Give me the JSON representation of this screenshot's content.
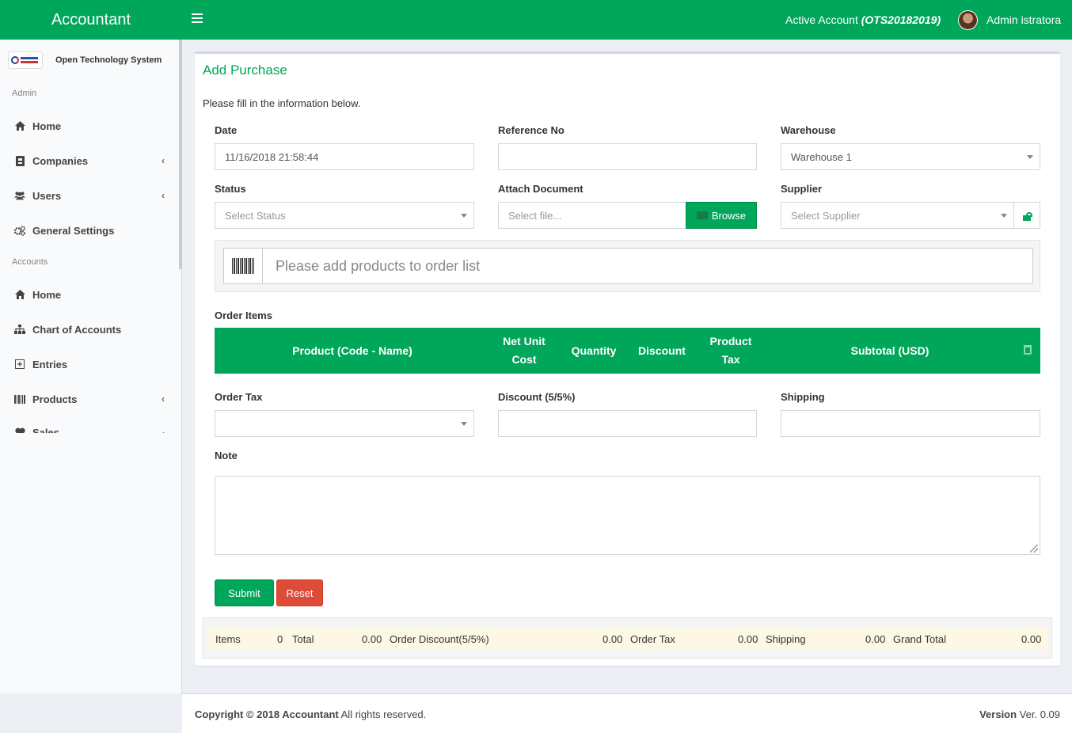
{
  "header": {
    "brand": "Accountant",
    "active_account_label": "Active Account",
    "active_account_code": "(OTS20182019)",
    "user_name": "Admin istratora"
  },
  "sidebar": {
    "org_name": "Open Technology System",
    "sections": [
      {
        "title": "Admin"
      },
      {
        "title": "Accounts"
      }
    ],
    "items": [
      {
        "label": "Home",
        "icon": "home-icon"
      },
      {
        "label": "Companies",
        "icon": "building-icon"
      },
      {
        "label": "Users",
        "icon": "users-icon"
      },
      {
        "label": "General Settings",
        "icon": "cogs-icon"
      },
      {
        "label": "Home",
        "icon": "home-icon"
      },
      {
        "label": "Chart of Accounts",
        "icon": "sitemap-icon"
      },
      {
        "label": "Entries",
        "icon": "plus-square-icon"
      },
      {
        "label": "Products",
        "icon": "barcode-icon"
      },
      {
        "label": "Sales",
        "icon": "heart-icon"
      }
    ]
  },
  "form": {
    "title": "Add Purchase",
    "intro": "Please fill in the information below.",
    "date_label": "Date",
    "date_value": "11/16/2018 21:58:44",
    "reference_label": "Reference No",
    "reference_value": "",
    "warehouse_label": "Warehouse",
    "warehouse_value": "Warehouse 1",
    "status_label": "Status",
    "status_placeholder": "Select Status",
    "attach_label": "Attach Document",
    "attach_placeholder": "Select file...",
    "browse_label": "Browse",
    "supplier_label": "Supplier",
    "supplier_placeholder": "Select Supplier",
    "product_search_placeholder": "Please add products to order list",
    "order_items_label": "Order Items",
    "order_columns": [
      "Product (Code - Name)",
      "Net Unit Cost",
      "Quantity",
      "Discount",
      "Product Tax",
      "Subtotal (USD)"
    ],
    "order_tax_label": "Order Tax",
    "order_tax_value": "",
    "discount_label": "Discount (5/5%)",
    "discount_value": "",
    "shipping_label": "Shipping",
    "shipping_value": "",
    "note_label": "Note",
    "submit_label": "Submit",
    "reset_label": "Reset"
  },
  "totals": {
    "items_label": "Items",
    "items_value": "0",
    "total_label": "Total",
    "total_value": "0.00",
    "order_discount_label": "Order Discount(5/5%)",
    "order_discount_value": "0.00",
    "order_tax_label": "Order Tax",
    "order_tax_value": "0.00",
    "shipping_label": "Shipping",
    "shipping_value": "0.00",
    "grand_total_label": "Grand Total",
    "grand_total_value": "0.00"
  },
  "footer": {
    "copyright_bold": "Copyright © 2018 Accountant",
    "copyright_rest": " All rights reserved.",
    "version_label": "Version",
    "version_value": " Ver. 0.09"
  },
  "colors": {
    "primary": "#00a65a",
    "danger": "#dd4b39",
    "totals_bg": "#fcf8e3"
  }
}
